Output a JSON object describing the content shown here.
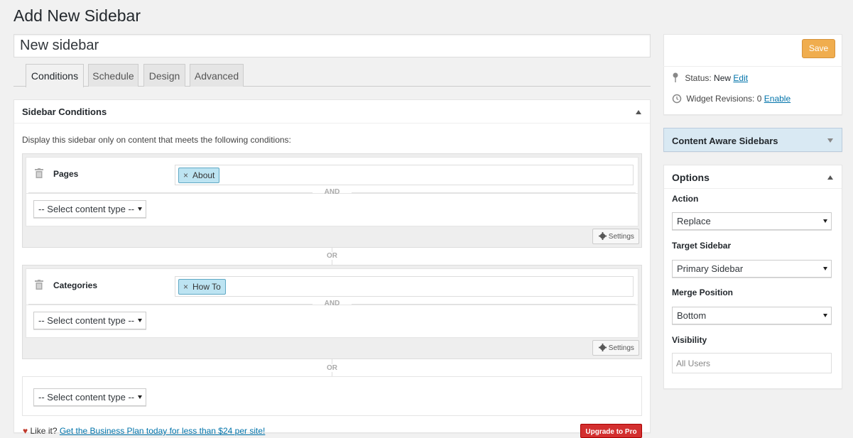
{
  "page": {
    "title": "Add New Sidebar"
  },
  "sidebar_name": {
    "value": "New sidebar"
  },
  "tabs": [
    {
      "label": "Conditions",
      "active": true
    },
    {
      "label": "Schedule",
      "active": false
    },
    {
      "label": "Design",
      "active": false
    },
    {
      "label": "Advanced",
      "active": false
    }
  ],
  "conditions_box": {
    "title": "Sidebar Conditions",
    "description": "Display this sidebar only on content that meets the following conditions:",
    "and_label": "AND",
    "or_label": "OR",
    "settings_label": "Settings",
    "select_placeholder": "-- Select content type --",
    "groups": [
      {
        "rule_label": "Pages",
        "tag": "About"
      },
      {
        "rule_label": "Categories",
        "tag": "How To"
      }
    ]
  },
  "footer": {
    "like_text": "Like it?",
    "link_text": "Get the Business Plan today for less than $24 per site!",
    "upgrade_label": "Upgrade to Pro",
    "heart_color": "#c0392b"
  },
  "publish_box": {
    "save_label": "Save",
    "status_label": "Status:",
    "status_value": "New",
    "edit_link": "Edit",
    "revisions_label": "Widget Revisions:",
    "revisions_value": "0",
    "enable_link": "Enable"
  },
  "cas_box": {
    "title": "Content Aware Sidebars"
  },
  "options_box": {
    "title": "Options",
    "action_label": "Action",
    "action_value": "Replace",
    "target_label": "Target Sidebar",
    "target_value": "Primary Sidebar",
    "merge_label": "Merge Position",
    "merge_value": "Bottom",
    "visibility_label": "Visibility",
    "visibility_placeholder": "All Users"
  },
  "colors": {
    "accent": "#0073aa",
    "save": "#f0ad4e",
    "upgrade": "#d32f2f",
    "tag_bg": "#bde4f2"
  },
  "icons": [
    "trash-icon",
    "gear-icon",
    "pin-icon",
    "history-icon",
    "heart-icon",
    "remove-tag-icon"
  ]
}
